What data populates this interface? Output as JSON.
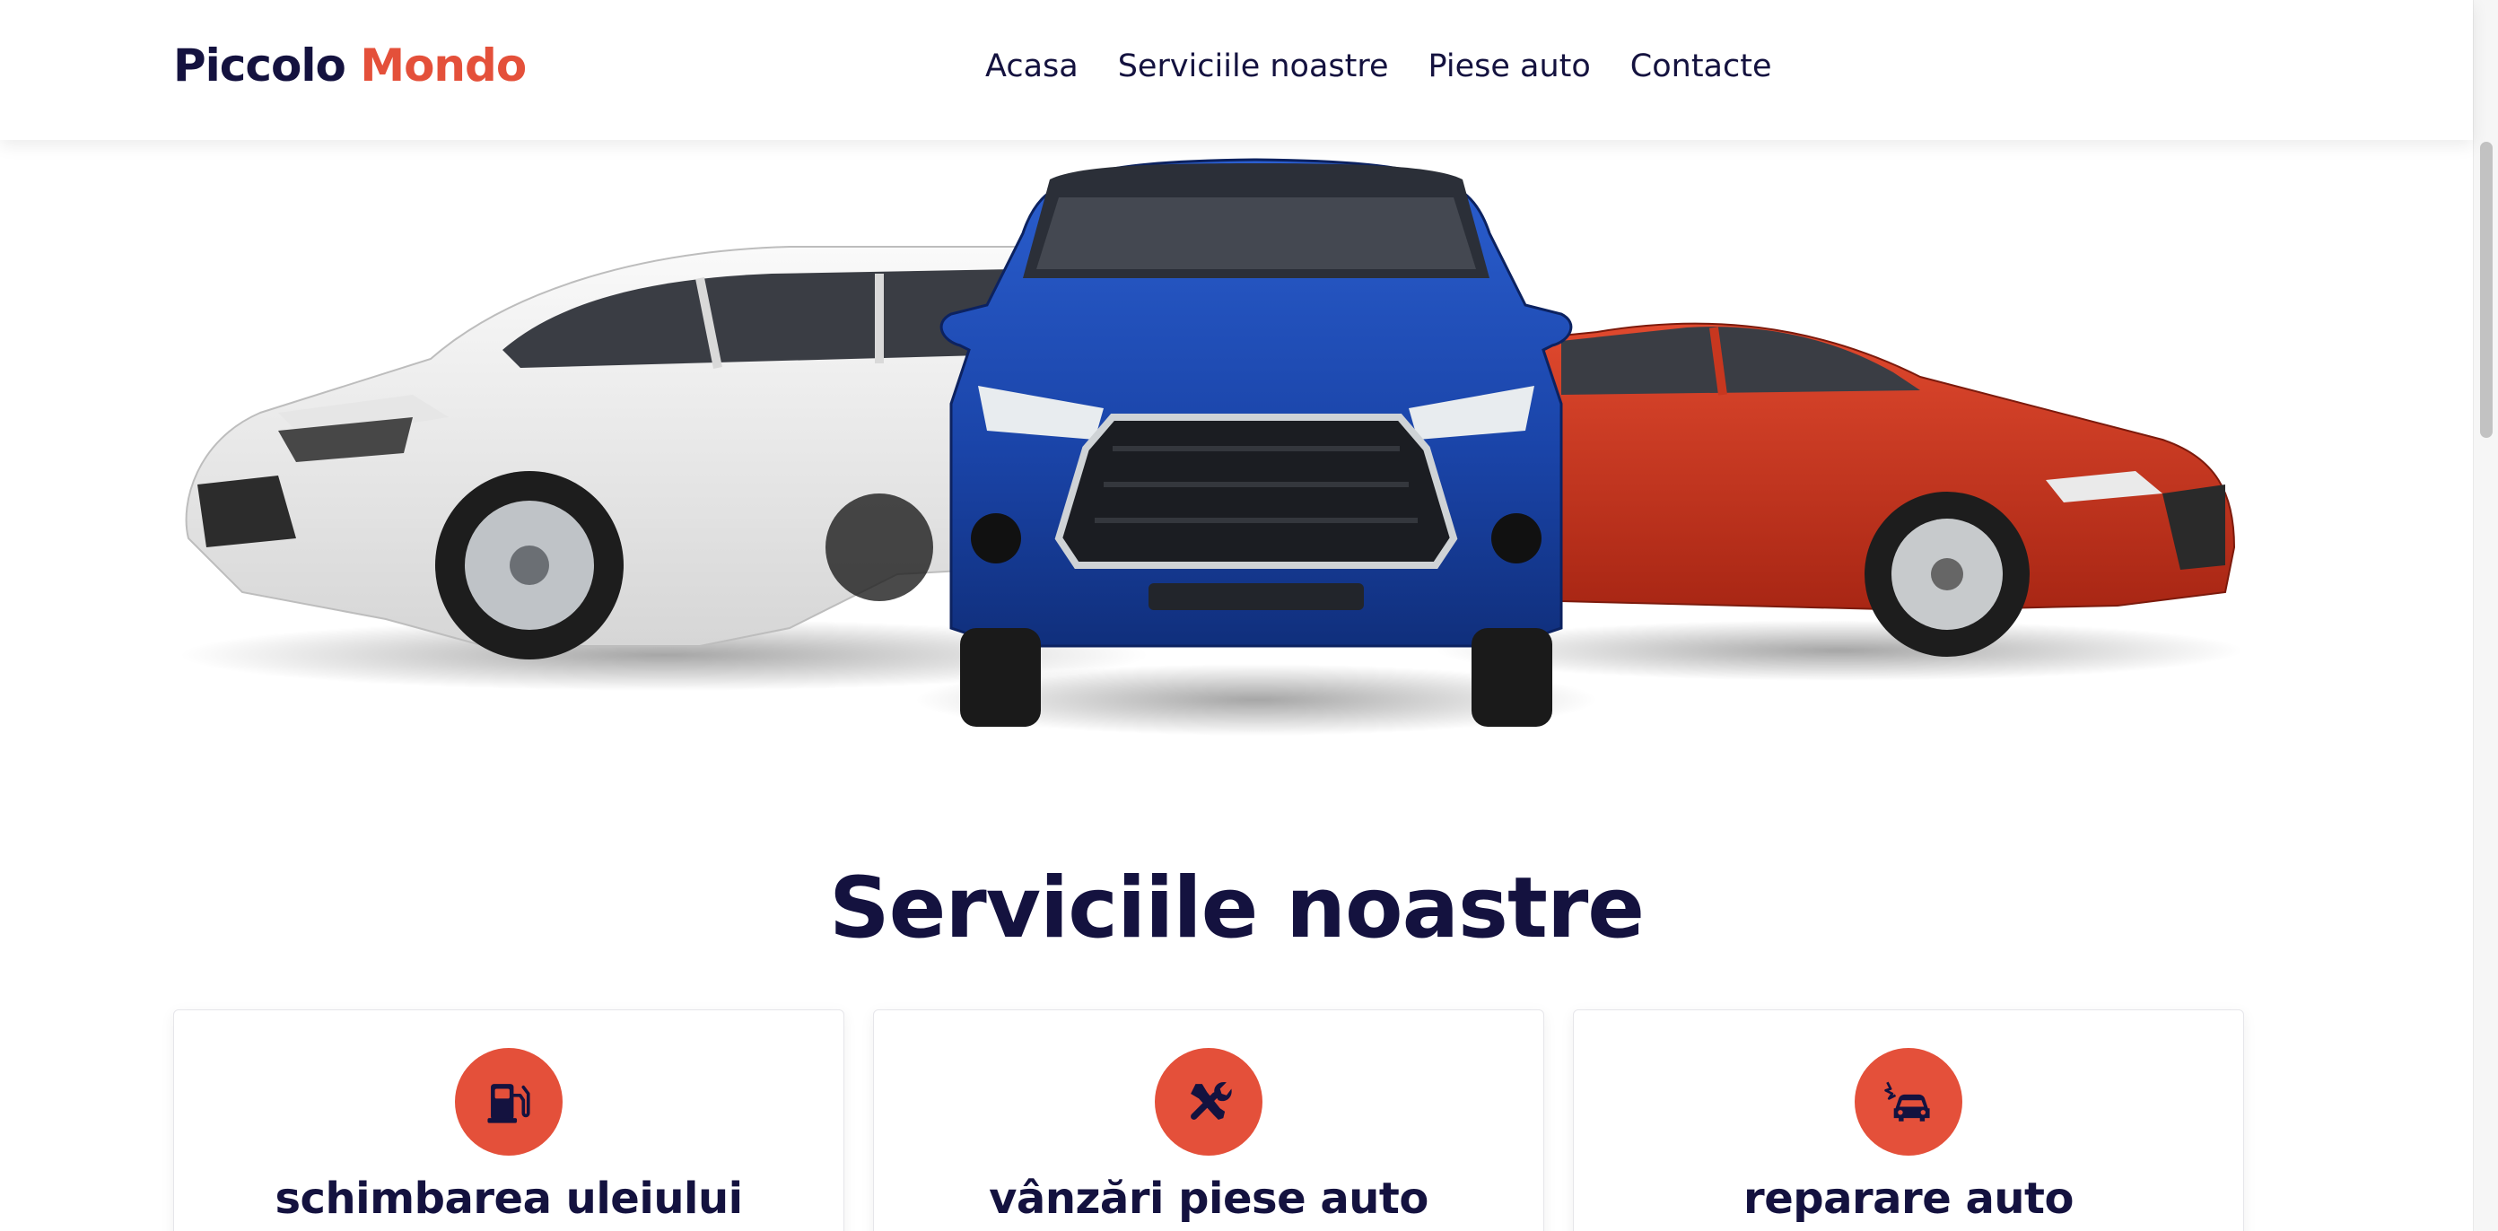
{
  "brand": {
    "first": "Piccolo",
    "second": "Mondo",
    "accent_color": "#e4503a",
    "dark_color": "#14123f"
  },
  "nav": {
    "items": [
      {
        "label": "Acasa"
      },
      {
        "label": "Serviciile noastre"
      },
      {
        "label": "Piese auto"
      },
      {
        "label": "Contacte"
      }
    ]
  },
  "hero": {
    "image": "three-cars-white-blue-red"
  },
  "services": {
    "title_highlight": "Serviciile",
    "title_rest": "noastre",
    "cards": [
      {
        "title": "schimbarea uleiului",
        "icon": "fuel-pump-icon"
      },
      {
        "title": "vânzări piese auto",
        "icon": "tools-icon"
      },
      {
        "title": "reparare auto",
        "icon": "car-crash-icon"
      }
    ]
  }
}
